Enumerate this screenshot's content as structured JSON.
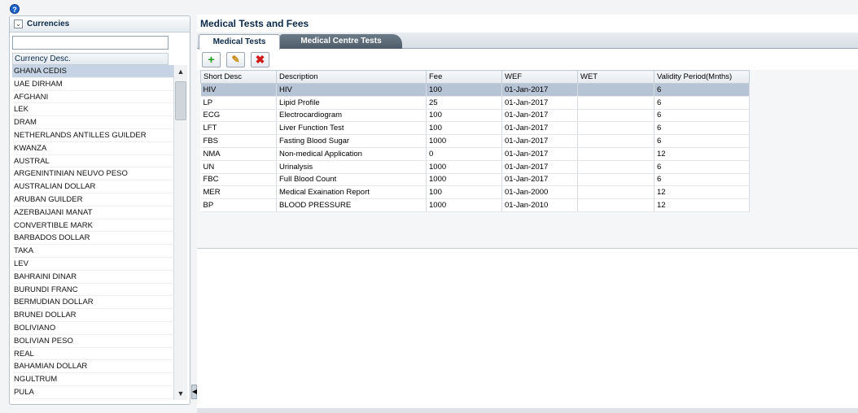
{
  "help_icon": "?",
  "currencies_panel": {
    "title": "Currencies",
    "filter_value": "",
    "column_header": "Currency Desc.",
    "selected_index": 0,
    "items": [
      "GHANA CEDIS",
      "UAE DIRHAM",
      "AFGHANI",
      "LEK",
      "DRAM",
      "NETHERLANDS ANTILLES GUILDER",
      "KWANZA",
      "AUSTRAL",
      "ARGENINTINIAN NEUVO PESO",
      "AUSTRALIAN DOLLAR",
      "ARUBAN GUILDER",
      "AZERBAIJANI MANAT",
      "CONVERTIBLE MARK",
      "BARBADOS DOLLAR",
      "TAKA",
      "LEV",
      "BAHRAINI DINAR",
      "BURUNDI FRANC",
      "BERMUDIAN DOLLAR",
      "BRUNEI DOLLAR",
      "BOLIVIANO",
      "BOLIVIAN PESO",
      "REAL",
      "BAHAMIAN DOLLAR",
      "NGULTRUM",
      "PULA"
    ]
  },
  "main": {
    "title": "Medical Tests and Fees",
    "tabs": [
      {
        "label": "Medical Tests",
        "active": true
      },
      {
        "label": "Medical Centre Tests",
        "active": false
      }
    ],
    "toolbar": {
      "add_icon": "+",
      "edit_icon": "✎",
      "delete_icon": "✖"
    },
    "table": {
      "columns": [
        "Short Desc",
        "Description",
        "Fee",
        "WEF",
        "WET",
        "Validity Period(Mnths)"
      ],
      "selected_index": 0,
      "rows": [
        [
          "HIV",
          "HIV",
          "100",
          "01-Jan-2017",
          "",
          "6"
        ],
        [
          "LP",
          "Lipid Profile",
          "25",
          "01-Jan-2017",
          "",
          "6"
        ],
        [
          "ECG",
          "Electrocardiogram",
          "100",
          "01-Jan-2017",
          "",
          "6"
        ],
        [
          "LFT",
          "Liver Function Test",
          "100",
          "01-Jan-2017",
          "",
          "6"
        ],
        [
          "FBS",
          "Fasting Blood Sugar",
          "1000",
          "01-Jan-2017",
          "",
          "6"
        ],
        [
          "NMA",
          "Non-medical Application",
          "0",
          "01-Jan-2017",
          "",
          "12"
        ],
        [
          "UN",
          "Urinalysis",
          "1000",
          "01-Jan-2017",
          "",
          "6"
        ],
        [
          "FBC",
          "Full Blood Count",
          "1000",
          "01-Jan-2017",
          "",
          "6"
        ],
        [
          "MER",
          "Medical Exaination Report",
          "100",
          "01-Jan-2000",
          "",
          "12"
        ],
        [
          "BP",
          "BLOOD PRESSURE",
          "1000",
          "01-Jan-2010",
          "",
          "12"
        ]
      ]
    }
  },
  "colors": {
    "selection": "#c5d3e4",
    "grid_selection": "#b7c4d6",
    "title_text": "#0c2a4a"
  }
}
